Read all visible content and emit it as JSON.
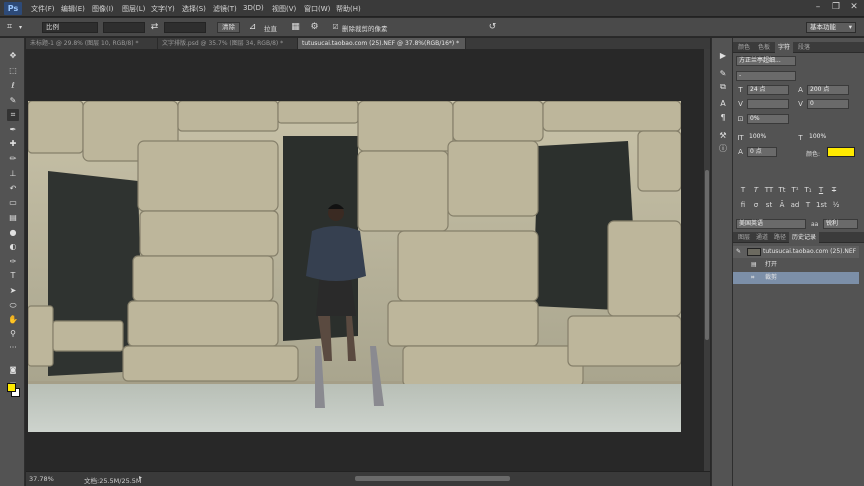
{
  "app": {
    "logo": "Ps"
  },
  "menu": {
    "items": [
      "文件(F)",
      "编辑(E)",
      "图像(I)",
      "图层(L)",
      "文字(Y)",
      "选择(S)",
      "滤镜(T)",
      "3D(D)",
      "视图(V)",
      "窗口(W)",
      "帮助(H)"
    ]
  },
  "options": {
    "ratio_value": "比例",
    "straighten_label": "拉直",
    "delete_cropped_label": "删除裁剪的像素",
    "delete_cropped_checked": true,
    "preset": "基本功能",
    "clear_label": "清除"
  },
  "tabs": [
    {
      "label": "未标题-1 @ 29.8% (图层 10, RGB/8) *",
      "active": false
    },
    {
      "label": "文字排版.psd @ 35.7% (图层 34, RGB/8) *",
      "active": false
    },
    {
      "label": "tutusucai.taobao.com (25).NEF @ 37.8%(RGB/16*) *",
      "active": true
    }
  ],
  "status": {
    "zoom": "37.78%",
    "doc": "文档:25.5M/25.5M"
  },
  "character_panel": {
    "tabs": [
      "颜色",
      "色板",
      "字符",
      "段落"
    ],
    "active_tab": "字符",
    "font_family": "方正兰亭超细...",
    "font_style": "-",
    "font_size": "24 点",
    "leading": "200 点",
    "kerning": "",
    "tracking": "0",
    "baseline_shift": "0%",
    "vertical_scale": "100%",
    "horizontal_scale": "100%",
    "baseline": "0 点",
    "color_label": "颜色:",
    "text_color": "#ffea00",
    "language": "美国英语",
    "antialias": "锐利",
    "aa_prefix": "aa"
  },
  "history_panel": {
    "tabs": [
      "图层",
      "通道",
      "路径",
      "历史记录"
    ],
    "active_tab": "历史记录",
    "snapshot": "tutusucai.taobao.com (25).NEF",
    "steps": [
      "打开",
      "裁剪"
    ],
    "selected_step": 1
  },
  "colors": {
    "foreground": "#ffea00",
    "background": "#ffffff"
  }
}
